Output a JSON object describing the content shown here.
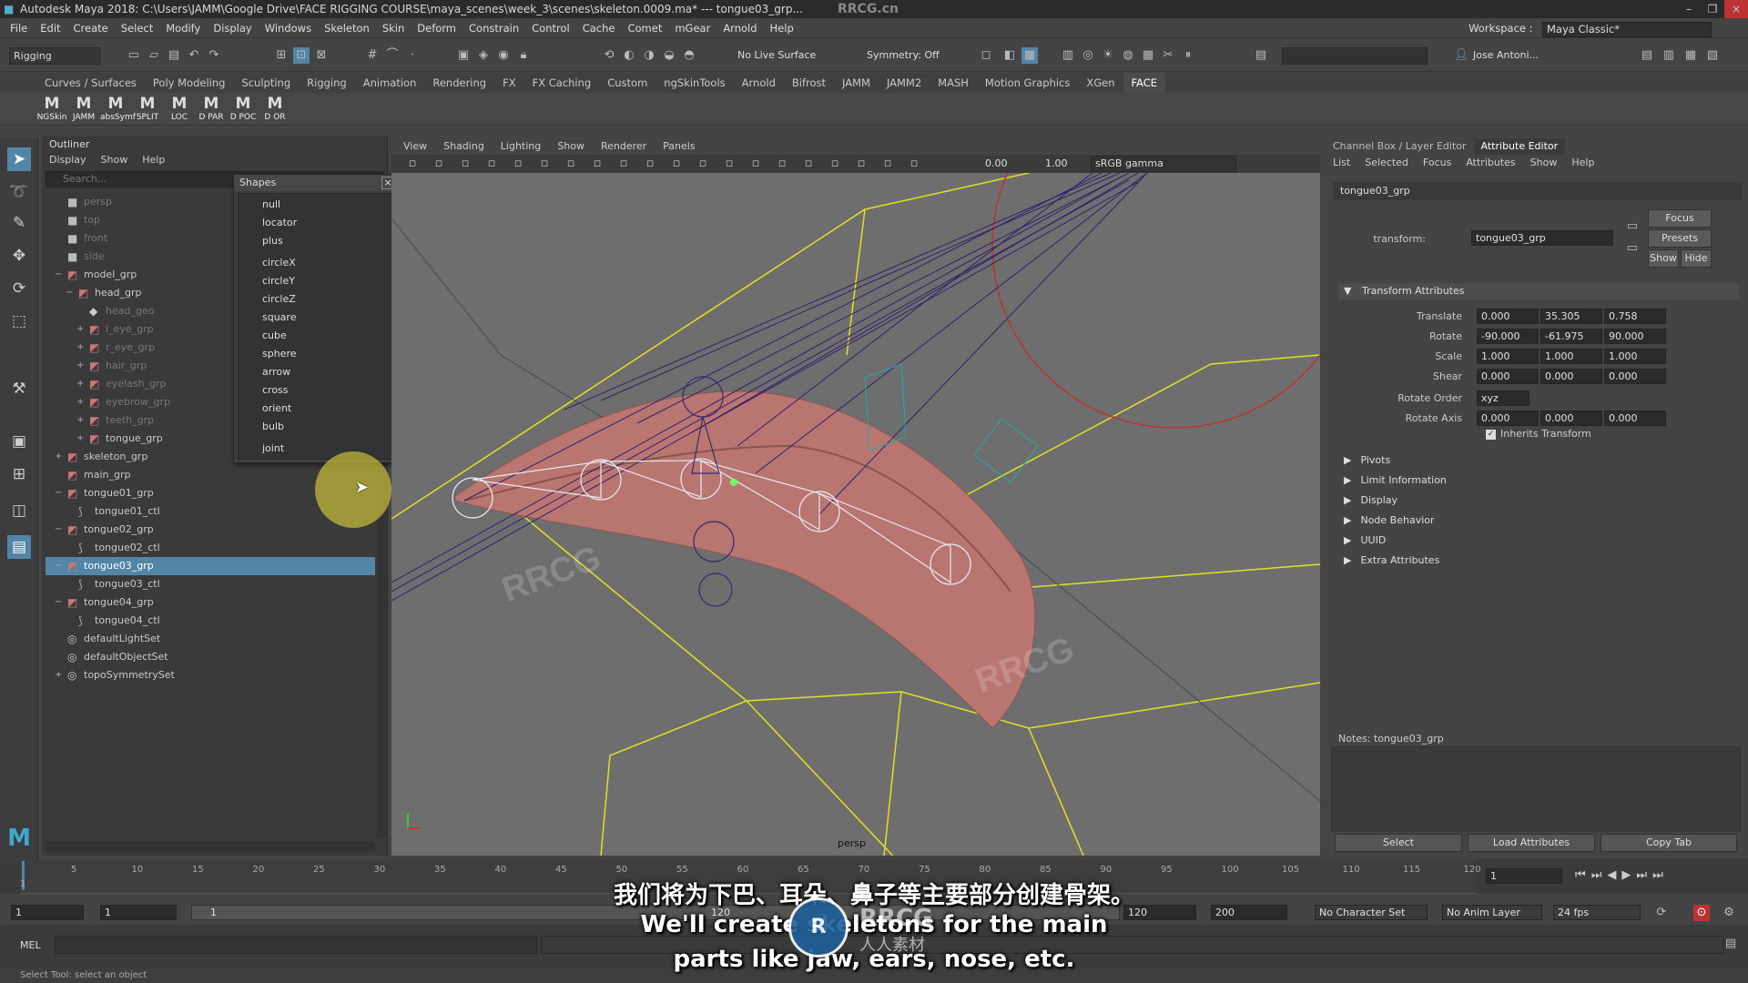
{
  "title": "Autodesk Maya 2018: C:\\Users\\JAMM\\Google Drive\\FACE RIGGING COURSE\\maya_scenes\\week_3\\scenes\\skeleton.0009.ma*  ---  tongue03_grp...",
  "watermark_top": "RRCG.cn",
  "menus": [
    "File",
    "Edit",
    "Create",
    "Select",
    "Modify",
    "Display",
    "Windows",
    "Skeleton",
    "Skin",
    "Deform",
    "Constrain",
    "Control",
    "Cache",
    "Comet",
    "mGear",
    "Arnold",
    "Help"
  ],
  "workspace": {
    "label": "Workspace :",
    "value": "Maya Classic*"
  },
  "status": {
    "menuset": "Rigging",
    "live_surface": "No Live Surface",
    "symmetry": "Symmetry: Off",
    "user": "Jose Antoni..."
  },
  "shelf_tabs": [
    "Curves / Surfaces",
    "Poly Modeling",
    "Sculpting",
    "Rigging",
    "Animation",
    "Rendering",
    "FX",
    "FX Caching",
    "Custom",
    "ngSkinTools",
    "Arnold",
    "Bifrost",
    "JAMM",
    "JAMM2",
    "MASH",
    "Motion Graphics",
    "XGen",
    "FACE"
  ],
  "shelf_active": "FACE",
  "shelf_buttons": [
    "NGSkin",
    "JAMM",
    "absSymf",
    "SPLIT",
    "LOC",
    "D PAR",
    "D POC",
    "D OR"
  ],
  "outliner": {
    "title": "Outliner",
    "menu": [
      "Display",
      "Show",
      "Help"
    ],
    "search_placeholder": "Search...",
    "rows": [
      {
        "label": "persp",
        "indent": 0,
        "icon": "camera",
        "dim": true,
        "exp": ""
      },
      {
        "label": "top",
        "indent": 0,
        "icon": "camera",
        "dim": true,
        "exp": ""
      },
      {
        "label": "front",
        "indent": 0,
        "icon": "camera",
        "dim": true,
        "exp": ""
      },
      {
        "label": "side",
        "indent": 0,
        "icon": "camera",
        "dim": true,
        "exp": ""
      },
      {
        "label": "model_grp",
        "indent": 0,
        "icon": "group",
        "dim": false,
        "exp": "−"
      },
      {
        "label": "head_grp",
        "indent": 1,
        "icon": "group",
        "dim": false,
        "exp": "−"
      },
      {
        "label": "head_geo",
        "indent": 2,
        "icon": "mesh",
        "dim": true,
        "exp": ""
      },
      {
        "label": "l_eye_grp",
        "indent": 2,
        "icon": "group",
        "dim": true,
        "exp": "+"
      },
      {
        "label": "r_eye_grp",
        "indent": 2,
        "icon": "group",
        "dim": true,
        "exp": "+"
      },
      {
        "label": "hair_grp",
        "indent": 2,
        "icon": "group",
        "dim": true,
        "exp": "+"
      },
      {
        "label": "eyelash_grp",
        "indent": 2,
        "icon": "group",
        "dim": true,
        "exp": "+"
      },
      {
        "label": "eyebrow_grp",
        "indent": 2,
        "icon": "group",
        "dim": true,
        "exp": "+"
      },
      {
        "label": "teeth_grp",
        "indent": 2,
        "icon": "group",
        "dim": true,
        "exp": "+"
      },
      {
        "label": "tongue_grp",
        "indent": 2,
        "icon": "group",
        "dim": false,
        "exp": "+"
      },
      {
        "label": "skeleton_grp",
        "indent": 0,
        "icon": "group",
        "dim": false,
        "exp": "+"
      },
      {
        "label": "main_grp",
        "indent": 0,
        "icon": "group",
        "dim": false,
        "exp": ""
      },
      {
        "label": "tongue01_grp",
        "indent": 0,
        "icon": "group",
        "dim": false,
        "exp": "−"
      },
      {
        "label": "tongue01_ctl",
        "indent": 1,
        "icon": "curve",
        "dim": false,
        "exp": ""
      },
      {
        "label": "tongue02_grp",
        "indent": 0,
        "icon": "group",
        "dim": false,
        "exp": "−"
      },
      {
        "label": "tongue02_ctl",
        "indent": 1,
        "icon": "curve",
        "dim": false,
        "exp": ""
      },
      {
        "label": "tongue03_grp",
        "indent": 0,
        "icon": "group",
        "dim": false,
        "exp": "−",
        "selected": true
      },
      {
        "label": "tongue03_ctl",
        "indent": 1,
        "icon": "curve",
        "dim": false,
        "exp": ""
      },
      {
        "label": "tongue04_grp",
        "indent": 0,
        "icon": "group",
        "dim": false,
        "exp": "−"
      },
      {
        "label": "tongue04_ctl",
        "indent": 1,
        "icon": "curve",
        "dim": false,
        "exp": ""
      },
      {
        "label": "defaultLightSet",
        "indent": 0,
        "icon": "set",
        "dim": false,
        "exp": ""
      },
      {
        "label": "defaultObjectSet",
        "indent": 0,
        "icon": "set",
        "dim": false,
        "exp": ""
      },
      {
        "label": "topoSymmetrySet",
        "indent": 0,
        "icon": "set",
        "dim": false,
        "exp": "+"
      }
    ]
  },
  "shapes": {
    "title": "Shapes",
    "close": "×",
    "items": [
      "null",
      "locator",
      "plus",
      "circleX",
      "circleY",
      "circleZ",
      "square",
      "cube",
      "sphere",
      "arrow",
      "cross",
      "orient",
      "bulb",
      "joint"
    ]
  },
  "viewport": {
    "menu": [
      "View",
      "Shading",
      "Lighting",
      "Show",
      "Renderer",
      "Panels"
    ],
    "near": "0.00",
    "far": "1.00",
    "colorspace": "sRGB gamma",
    "camera": "persp"
  },
  "channel": {
    "tabs": [
      "Channel Box / Layer Editor",
      "Attribute Editor"
    ],
    "active": "Attribute Editor",
    "menu": [
      "List",
      "Selected",
      "Focus",
      "Attributes",
      "Show",
      "Help"
    ]
  },
  "attr": {
    "node_tab": "tongue03_grp",
    "transform_label": "transform:",
    "transform_value": "tongue03_grp",
    "buttons": [
      "Focus",
      "Presets",
      "Show",
      "Hide"
    ],
    "section": "Transform Attributes",
    "translate": {
      "label": "Translate",
      "values": [
        "0.000",
        "35.305",
        "0.758"
      ]
    },
    "rotate": {
      "label": "Rotate",
      "values": [
        "-90.000",
        "-61.975",
        "90.000"
      ]
    },
    "scale": {
      "label": "Scale",
      "values": [
        "1.000",
        "1.000",
        "1.000"
      ]
    },
    "shear": {
      "label": "Shear",
      "values": [
        "0.000",
        "0.000",
        "0.000"
      ]
    },
    "rotate_order": {
      "label": "Rotate Order",
      "value": "xyz"
    },
    "rotate_axis": {
      "label": "Rotate Axis",
      "values": [
        "0.000",
        "0.000",
        "0.000"
      ]
    },
    "inherits": "Inherits Transform",
    "collapsed": [
      "Pivots",
      "Limit Information",
      "Display",
      "Node Behavior",
      "UUID",
      "Extra Attributes"
    ],
    "notes": "Notes:  tongue03_grp",
    "bottom": [
      "Select",
      "Load Attributes",
      "Copy Tab"
    ]
  },
  "timeline": {
    "ticks": [
      "5",
      "10",
      "15",
      "20",
      "25",
      "30",
      "35",
      "40",
      "45",
      "50",
      "55",
      "60",
      "65",
      "70",
      "75",
      "80",
      "85",
      "90",
      "95",
      "100",
      "105",
      "110",
      "115",
      "120"
    ],
    "start_tick": "1",
    "current": "1"
  },
  "range": {
    "start": "1",
    "start2": "1",
    "inner": "1",
    "inner_end": "120",
    "end": "120",
    "end2": "200",
    "charset": "No Character Set",
    "animlayer": "No Anim Layer",
    "fps": "24 fps"
  },
  "cmd": {
    "lang": "MEL",
    "help": "Select Tool: select an object"
  },
  "subtitles": {
    "cn": "我们将为下巴、耳朵、鼻子等主要部分创建骨架。",
    "en1": "We'll create skeletons for the main",
    "en2": "parts like jaw, ears, nose, etc."
  },
  "logo": {
    "text1": "RRCG",
    "text2": "人人素材"
  }
}
